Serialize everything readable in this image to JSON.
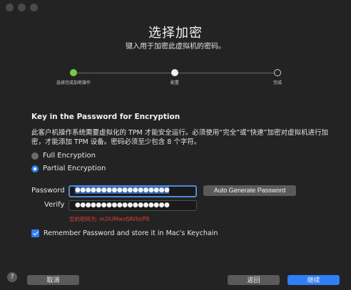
{
  "title": "选择加密",
  "subtitle": "键入用于加密此虚拟机的密码。",
  "steps": [
    {
      "label": "选择完成加密操作",
      "state": "active"
    },
    {
      "label": "配置",
      "state": "done"
    },
    {
      "label": "完成",
      "state": "todo"
    }
  ],
  "section_title": "Key in the Password for Encryption",
  "description": "此客户机操作系统需要虚拟化的 TPM 才能安全运行。必须使用“完全”或“快速”加密对虚拟机进行加密，才能添加 TPM 设备。密码必须至少包含 8 个字符。",
  "encryption": {
    "options": [
      "Full Encryption",
      "Partial Encryption"
    ],
    "selected": "Partial Encryption"
  },
  "password": {
    "label": "Password",
    "value": "●●●●●●●●●●●●●●●●●●"
  },
  "verify": {
    "label": "Verify",
    "value": "●●●●●●●●●●●●●●●●●●"
  },
  "auto_generate_label": "Auto Generate Password",
  "generated_hint": "您的密码为: m2iUMwofJAVbl/P8",
  "remember": {
    "label": "Remember Password and store it in Mac's Keychain",
    "checked": true
  },
  "footer": {
    "help": "?",
    "cancel": "取消",
    "back": "返回",
    "continue": "继续"
  },
  "colors": {
    "accent": "#2f7ef5",
    "step_active": "#7ac943",
    "hint": "#d9413a"
  }
}
